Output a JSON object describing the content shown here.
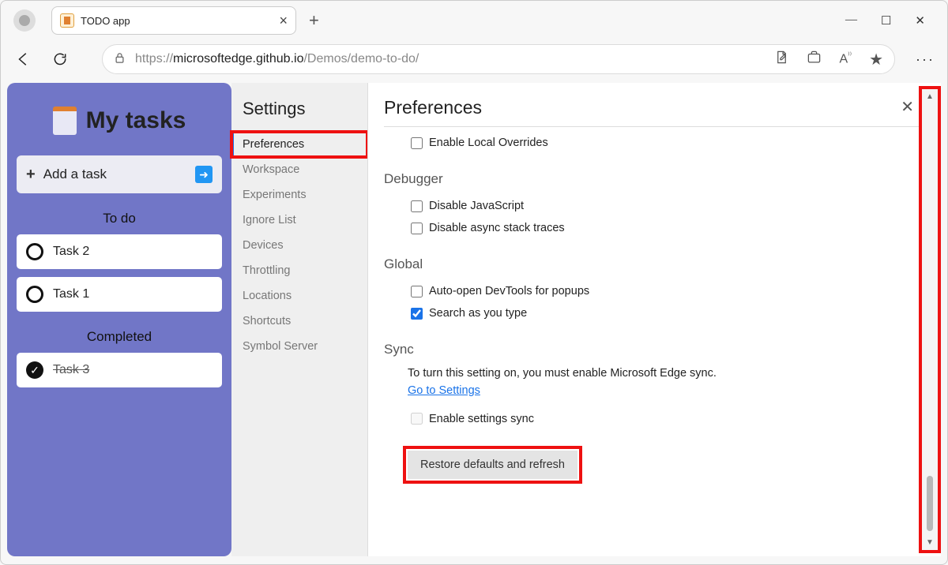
{
  "window": {
    "minimize": "—",
    "maximize": "☐",
    "close": "✕"
  },
  "tab": {
    "title": "TODO app"
  },
  "address": {
    "protocol": "https://",
    "host": "microsoftedge.github.io",
    "path": "/Demos/demo-to-do/"
  },
  "app": {
    "title": "My tasks",
    "add_task_label": "Add a task",
    "todo_label": "To do",
    "completed_label": "Completed",
    "tasks_todo": [
      "Task 2",
      "Task 1"
    ],
    "tasks_done": [
      "Task 3"
    ]
  },
  "settings": {
    "title": "Settings",
    "items": [
      "Preferences",
      "Workspace",
      "Experiments",
      "Ignore List",
      "Devices",
      "Throttling",
      "Locations",
      "Shortcuts",
      "Symbol Server"
    ]
  },
  "prefs": {
    "title": "Preferences",
    "enable_overrides": "Enable Local Overrides",
    "debugger_h": "Debugger",
    "disable_js": "Disable JavaScript",
    "disable_async": "Disable async stack traces",
    "global_h": "Global",
    "autoopen": "Auto-open DevTools for popups",
    "search_type": "Search as you type",
    "sync_h": "Sync",
    "sync_text_1": "To turn this setting on, you must enable Microsoft Edge sync. ",
    "sync_link": "Go to Settings",
    "enable_sync": "Enable settings sync",
    "restore": "Restore defaults and refresh"
  }
}
